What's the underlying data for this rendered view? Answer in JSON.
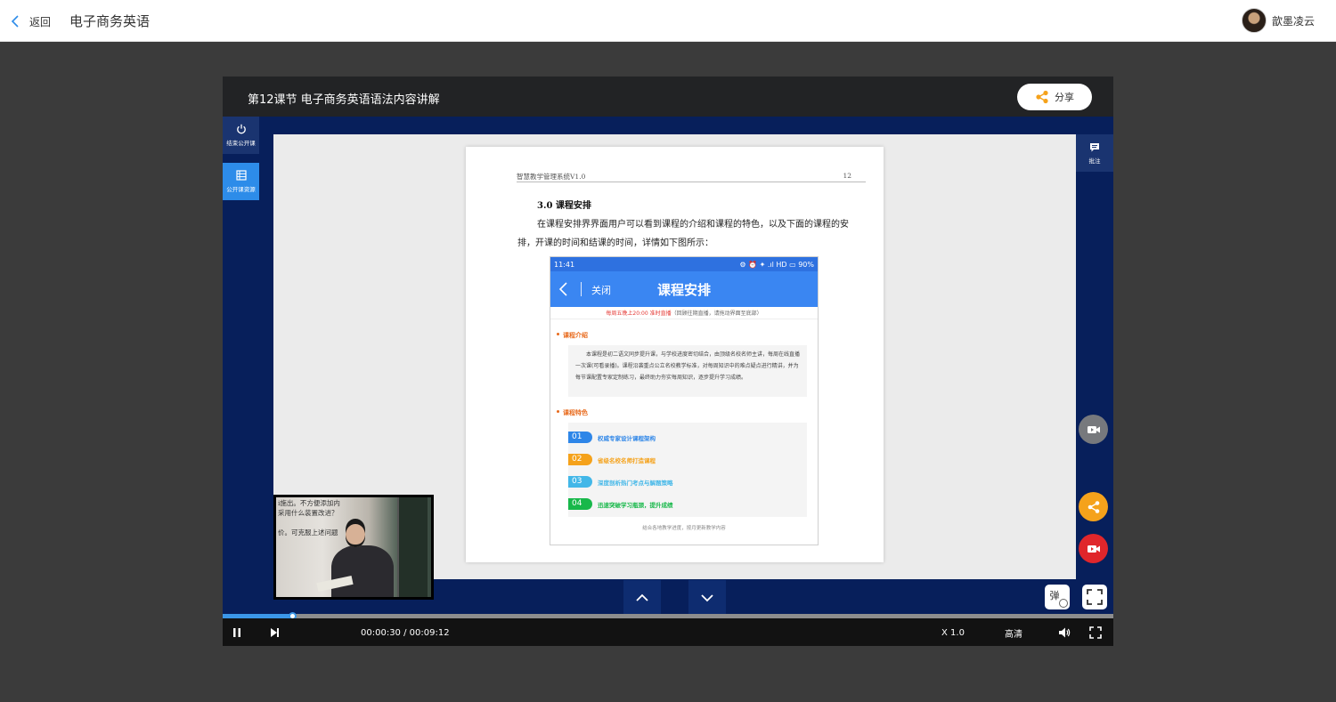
{
  "topbar": {
    "back_label": "返回",
    "course_title": "电子商务英语",
    "user_name": "歆墨凌云"
  },
  "player": {
    "lesson_title": "第12课节  电子商务英语语法内容讲解",
    "share_label": "分享",
    "left_buttons": [
      {
        "label": "结束公开课",
        "icon": "power-icon"
      },
      {
        "label": "公开课资源",
        "icon": "list-icon"
      }
    ],
    "right_note_label": "批注",
    "danmu_label": "弹",
    "accent": "#2d8ce9",
    "stage_color": "#071f5b"
  },
  "document": {
    "header_left": "智慧教学管理系统V1.0",
    "header_right": "12",
    "section_title": "3.0  课程安排",
    "paragraph": "在课程安排界界面用户可以看到课程的介绍和课程的特色，以及下面的课程的安排，开课的时间和结课的时间，详情如下图所示：",
    "phone": {
      "time": "11:41",
      "status_right": "⚙ ⏰ ✦ .ıl HD ▭ 90%",
      "close_label": "关闭",
      "title": "课程安排",
      "notice_red": "每周五晚上20:00 准时直播",
      "notice_rest": "（回顾往期直播，请拖动界面至底部）",
      "intro_heading": "课程介绍",
      "intro_text": "本课程是初二语文同步提升课，与学校进度密切结合，由顶级名校名师主讲，每周在线直播一次课(可看录播)。课程沿袭重点公立名校教学标准，对每周知识中的难点疑点进行精讲，并为每节课配置专家定制练习，最终助力夯实每周知识，逐步提升学习成绩。",
      "features_heading": "课程特色",
      "features": [
        {
          "num": "01",
          "text": "权威专家设计课程架构",
          "color": "#2e86e8"
        },
        {
          "num": "02",
          "text": "省级名校名师打造课程",
          "color": "#f5a21b"
        },
        {
          "num": "03",
          "text": "深度剖析热门考点与解题策略",
          "color": "#42b7e8"
        },
        {
          "num": "04",
          "text": "迅速突破学习瓶颈，提升成绩",
          "color": "#18b84a"
        }
      ],
      "footer": "结合各地教学进度，按月更新教学内容"
    }
  },
  "thumbnail": {
    "note_lines": [
      "i施出。不方便添加内",
      "采用什么装置改进？",
      "",
      "价。可克服上述问题"
    ]
  },
  "controls": {
    "time_display": "00:00:30 / 00:09:12",
    "speed": "X 1.0",
    "quality": "高清",
    "progress_fraction": 0.078
  }
}
